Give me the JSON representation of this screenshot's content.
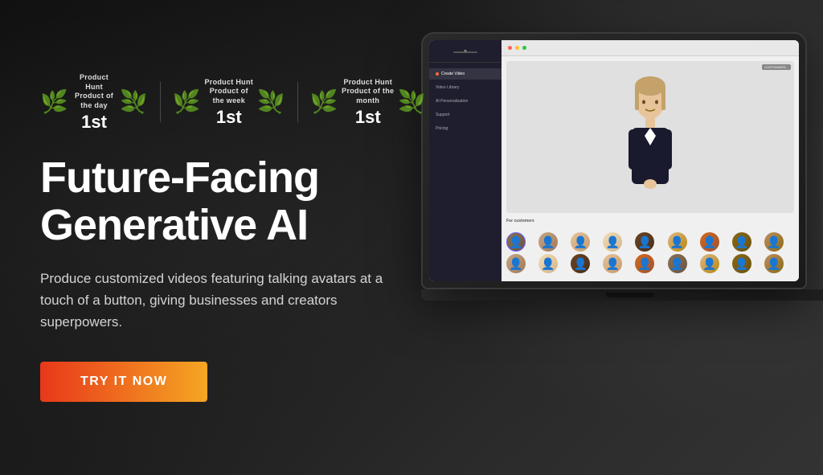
{
  "hero": {
    "heading_line1": "Future-Facing",
    "heading_line2": "Generative AI",
    "subtitle": "Produce customized videos featuring talking avatars at a touch of a button, giving businesses and creators superpowers.",
    "cta_label": "TRY IT NOW"
  },
  "awards": [
    {
      "title_line1": "Product Hunt",
      "title_line2": "Product of the day",
      "rank": "1st"
    },
    {
      "title_line1": "Product Hunt",
      "title_line2": "Product of the week",
      "rank": "1st"
    },
    {
      "title_line1": "Product Hunt",
      "title_line2": "Product of the month",
      "rank": "1st"
    }
  ],
  "app": {
    "toolbar_title": "Create Video",
    "sidebar_items": [
      {
        "label": "Create Video",
        "active": true
      },
      {
        "label": "Video Library",
        "active": false
      },
      {
        "label": "AI Personalization",
        "active": false
      },
      {
        "label": "Support",
        "active": false
      },
      {
        "label": "Pricing",
        "active": false
      }
    ],
    "section_label": "For customers",
    "preview_label": "CUSTOMIZED...",
    "avatar_count": 18
  },
  "colors": {
    "cta_gradient_start": "#e8381a",
    "cta_gradient_end": "#f5a623",
    "accent": "#6a5af9"
  }
}
